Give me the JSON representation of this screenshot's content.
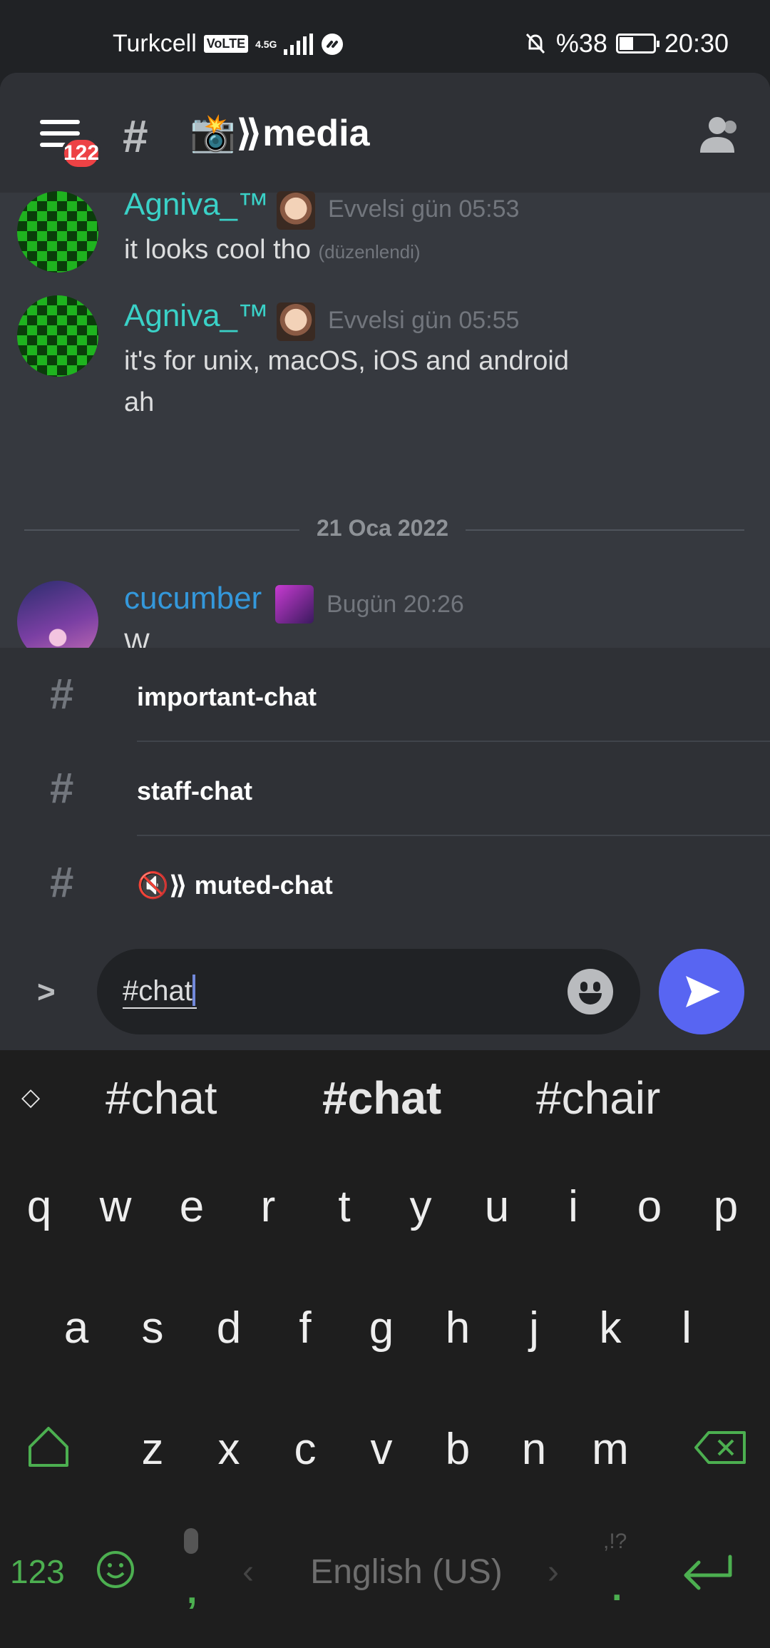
{
  "status": {
    "carrier": "Turkcell",
    "volte": "VoLTE",
    "network": "4.5G",
    "battery": "%38",
    "time": "20:30"
  },
  "header": {
    "badge_count": "122",
    "channel_title": "📸⟫media"
  },
  "messages": [
    {
      "user": "Agniva_™",
      "time": "Evvelsi gün 05:53",
      "text": "it looks cool tho",
      "edited": "(düzenlendi)"
    },
    {
      "user": "Agniva_™",
      "time": "Evvelsi gün 05:55",
      "text_line1": "it's for unix, macOS, iOS and android",
      "text_line2": "ah"
    },
    {
      "user": "cucumber",
      "time": "Bugün 20:26",
      "text": "W"
    }
  ],
  "date_divider": "21 Oca 2022",
  "autocomplete": [
    {
      "name": "important-chat"
    },
    {
      "name": "staff-chat"
    },
    {
      "name": "🔇⟫ muted-chat"
    }
  ],
  "input": {
    "value": "#chat"
  },
  "keyboard": {
    "suggestions": [
      "#chat",
      "#chat",
      "#chair"
    ],
    "row1": [
      "q",
      "w",
      "e",
      "r",
      "t",
      "y",
      "u",
      "i",
      "o",
      "p"
    ],
    "row2": [
      "a",
      "s",
      "d",
      "f",
      "g",
      "h",
      "j",
      "k",
      "l"
    ],
    "row3": [
      "z",
      "x",
      "c",
      "v",
      "b",
      "n",
      "m"
    ],
    "numbers_key": "123",
    "comma": ",",
    "period": ".",
    "punct_hint": ",!?",
    "space_label": "English (US)"
  },
  "colors": {
    "background": "#36393f",
    "header": "#2f3136",
    "accent": "#5865f2",
    "keyboard_accent": "#4caf50"
  }
}
